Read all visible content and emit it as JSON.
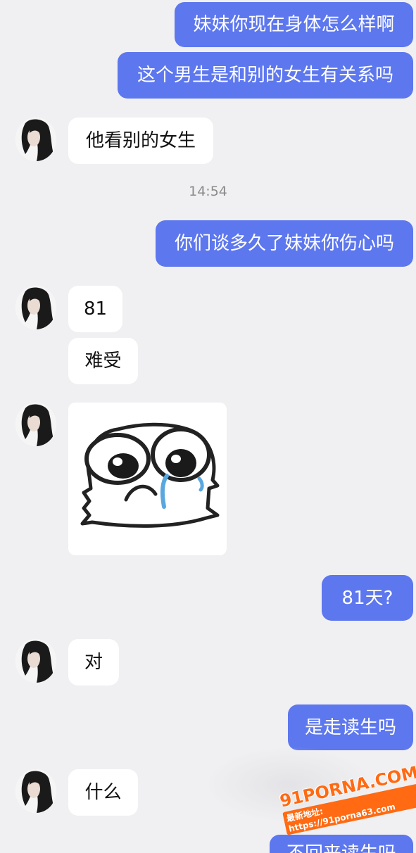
{
  "messages": [
    {
      "id": "m1",
      "side": "out",
      "text": "妹妹你现在身体怎么样啊"
    },
    {
      "id": "m2",
      "side": "out",
      "text": "这个男生是和别的女生有关系吗"
    },
    {
      "id": "m3",
      "side": "in",
      "text": "他看别的女生"
    },
    {
      "id": "m4",
      "side": "out",
      "text": "你们谈多久了妹妹你伤心吗"
    },
    {
      "id": "m5",
      "side": "in",
      "text": "81"
    },
    {
      "id": "m6",
      "side": "in",
      "text": "难受"
    },
    {
      "id": "m7",
      "side": "in",
      "type": "sticker",
      "sticker": "crying-face"
    },
    {
      "id": "m8",
      "side": "out",
      "text": "81天?"
    },
    {
      "id": "m9",
      "side": "in",
      "text": "对"
    },
    {
      "id": "m10",
      "side": "out",
      "text": "是走读生吗"
    },
    {
      "id": "m11",
      "side": "in",
      "text": "什么"
    },
    {
      "id": "m12",
      "side": "out",
      "text": "不回来读生吗",
      "partially_visible": true
    }
  ],
  "timestamp": "14:54",
  "watermark": {
    "main": "91PORNA.COM",
    "sub": "最新地址: https://91porna63.com"
  },
  "colors": {
    "outgoing_bubble": "#5d77ee",
    "incoming_bubble": "#ffffff",
    "background": "#f0f0f2",
    "timestamp_text": "#8a8a8a",
    "watermark": "#ff6a12"
  }
}
